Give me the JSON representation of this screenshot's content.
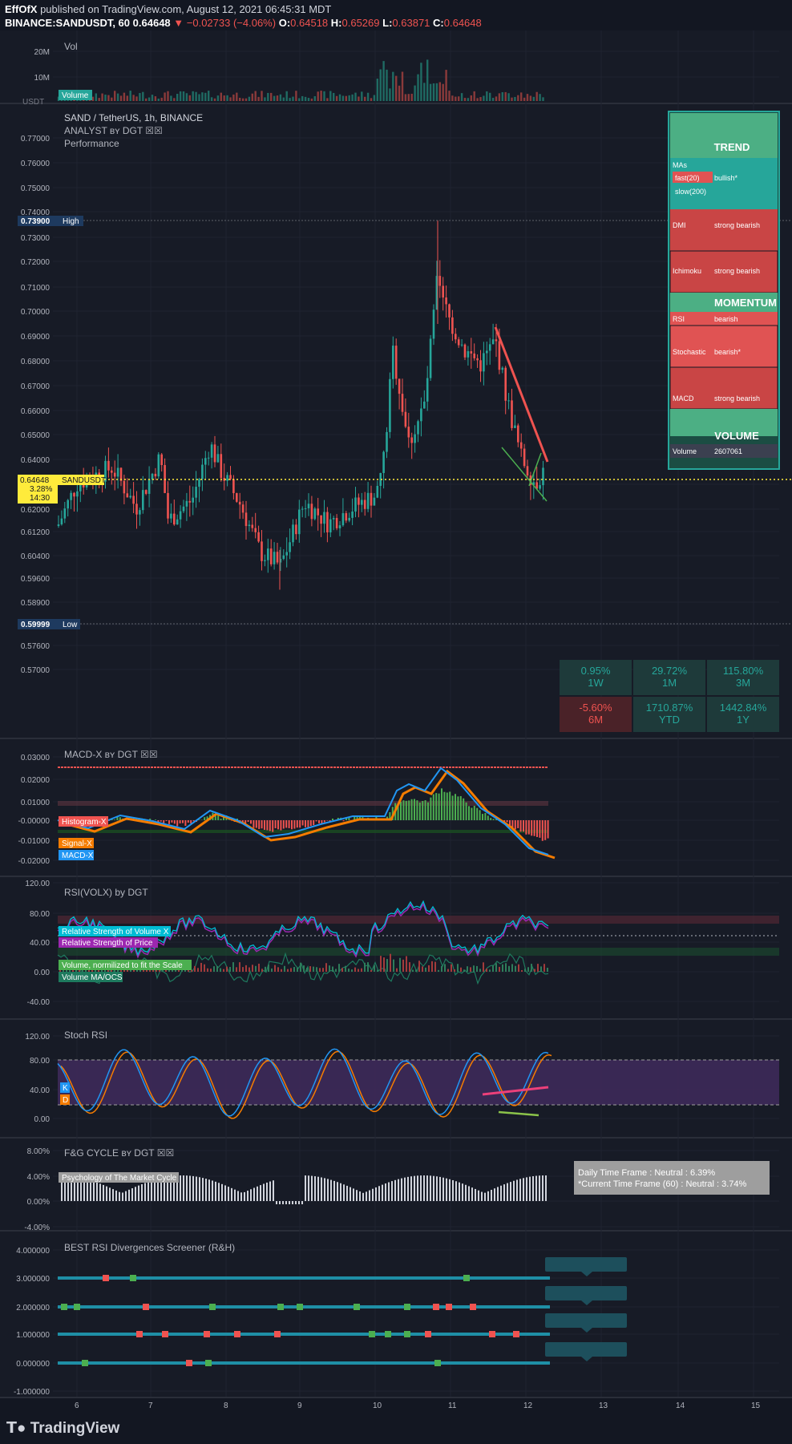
{
  "header": {
    "author": "EffOfX",
    "published": "published on TradingView.com, August 12, 2021 06:45:31 MDT",
    "symbol_line": "BINANCE:SANDUSDT, 60",
    "last": "0.64648",
    "change": "▼ −0.02733 (−4.06%)",
    "o_label": "O:",
    "o": "0.64518",
    "h_label": "H:",
    "h": "0.65269",
    "l_label": "L:",
    "l": "0.63871",
    "c_label": "C:",
    "c": "0.64648"
  },
  "colors": {
    "bg": "#131722",
    "up": "#26a69a",
    "down": "#ef5350",
    "grid": "#2a2e39",
    "text": "#b2b5be"
  },
  "volume_pane": {
    "title": "Vol",
    "ticks": [
      "20M",
      "10M"
    ],
    "tag": "Volume"
  },
  "price_pane": {
    "title": "SAND / TetherUS, 1h, BINANCE",
    "subtitle": "ANALYST ʙʏ DGT ☒☒",
    "subtitle2": "Performance",
    "currency": "USDT",
    "ticks": [
      "0.77000",
      "0.76000",
      "0.75000",
      "0.74000",
      "0.73000",
      "0.72000",
      "0.71000",
      "0.70000",
      "0.69000",
      "0.68000",
      "0.67000",
      "0.66000",
      "0.65000",
      "0.64000",
      "0.63000",
      "0.62000",
      "0.61200",
      "0.60400",
      "0.59600",
      "0.58900",
      "0.58200",
      "0.57600",
      "0.57000"
    ],
    "high_price": "0.73900",
    "high_label": "High",
    "low_price": "0.59999",
    "low_label": "Low",
    "last_price": "0.64648",
    "last_symbol": "SANDUSDT",
    "last_pct": "3.28%",
    "last_time": "14:30",
    "performance": [
      {
        "value": "0.95%",
        "period": "1W",
        "color": "#26a69a"
      },
      {
        "value": "29.72%",
        "period": "1M",
        "color": "#26a69a"
      },
      {
        "value": "115.80%",
        "period": "3M",
        "color": "#26a69a"
      },
      {
        "value": "-5.60%",
        "period": "6M",
        "color": "#ef5350"
      },
      {
        "value": "1710.87%",
        "period": "YTD",
        "color": "#26a69a"
      },
      {
        "value": "1442.84%",
        "period": "1Y",
        "color": "#26a69a"
      }
    ],
    "analyst": {
      "trend_title": "TREND",
      "mas": "MAs",
      "rows": [
        {
          "name": "fast(20)",
          "value": "bullish*"
        },
        {
          "name": "slow(200)",
          "value": ""
        },
        {
          "name": "DMI",
          "value": "strong bearish"
        },
        {
          "name": "Ichimoku",
          "value": "strong bearish"
        },
        {
          "name": "RSI",
          "value": "bearish"
        },
        {
          "name": "Stochastic",
          "value": "bearish*"
        },
        {
          "name": "MACD",
          "value": "strong bearish"
        }
      ],
      "momentum_title": "MOMENTUM",
      "volume_title": "VOLUME",
      "volume_name": "Volume",
      "volume_value": "2607061"
    }
  },
  "macd_pane": {
    "title": "MACD-X ʙʏ DGT ☒☒",
    "ticks": [
      "0.03000",
      "0.02000",
      "0.01000",
      "-0.00000",
      "-0.01000",
      "-0.02000"
    ],
    "tags": [
      "Histogram-X",
      "Signal-X",
      "MACD-X"
    ]
  },
  "rsi_pane": {
    "title": "RSI(VOLX) by DGT",
    "ticks": [
      "120.00",
      "80.00",
      "40.00",
      "0.00",
      "-40.00"
    ],
    "tags": [
      "Relative Strength of Volume X",
      "Relative Strength of Price",
      "Volume, normilized to fit the Scale",
      "Volume MA/OCS"
    ]
  },
  "stoch_pane": {
    "title": "Stoch RSI",
    "ticks": [
      "120.00",
      "80.00",
      "40.00",
      "0.00"
    ],
    "tags": [
      "K",
      "D"
    ]
  },
  "fg_pane": {
    "title": "F&G CYCLE ʙʏ DGT ☒☒",
    "ticks": [
      "8.00%",
      "4.00%",
      "0.00%",
      "-4.00%"
    ],
    "tag": "Psychology of The Market Cycle",
    "info_line1": "Daily Time Frame : Neutral : 6.39%",
    "info_line2": "*Current Time Frame (60) : Neutral : 3.74%"
  },
  "div_pane": {
    "title": "BEST RSI Divergences Screener (R&H)",
    "ticks": [
      "4.000000",
      "3.000000",
      "2.000000",
      "1.000000",
      "0.000000",
      "-1.000000"
    ]
  },
  "time_axis": [
    "6",
    "7",
    "8",
    "9",
    "10",
    "11",
    "12",
    "13",
    "14",
    "15"
  ],
  "footer": {
    "logo": "TradingView"
  },
  "chart_data": {
    "type": "candlestick",
    "title": "SAND / TetherUS, 1h, BINANCE",
    "x": [
      "Aug 6",
      "Aug 7",
      "Aug 8",
      "Aug 9",
      "Aug 10",
      "Aug 11",
      "Aug 12"
    ],
    "series": [
      {
        "name": "Close",
        "values": [
          0.624,
          0.641,
          0.658,
          0.618,
          0.645,
          0.702,
          0.64648
        ]
      }
    ],
    "high": 0.739,
    "low": 0.59999,
    "last": 0.64648,
    "ylim": [
      0.567,
      0.778
    ]
  }
}
